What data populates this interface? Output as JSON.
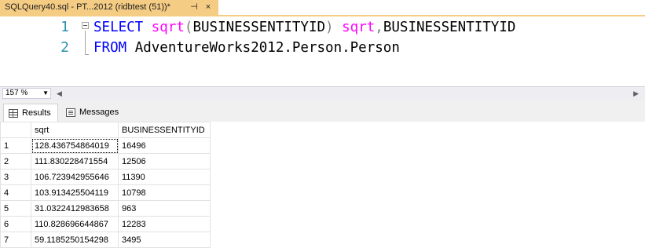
{
  "tab": {
    "title": "SQLQuery40.sql - PT...2012 (ridbtest (51))*",
    "pin_glyph": "⊣",
    "close_glyph": "×"
  },
  "editor": {
    "lines": [
      {
        "num": "1"
      },
      {
        "num": "2"
      }
    ],
    "line1": {
      "kw_select": "SELECT",
      "fn_sqrt": "sqrt",
      "paren_open": "(",
      "col": "BUSINESSENTITYID",
      "paren_close": ")",
      "alias": "sqrt",
      "comma": ",",
      "col2": "BUSINESSENTITYID"
    },
    "line2": {
      "kw_from": "FROM",
      "table": "AdventureWorks2012.Person.Person"
    }
  },
  "zoom": {
    "value": "157 %"
  },
  "results_tabs": {
    "results_label": "Results",
    "messages_label": "Messages"
  },
  "grid": {
    "columns": [
      "sqrt",
      "BUSINESSENTITYID"
    ],
    "rows": [
      {
        "n": "1",
        "sqrt": "128.436754864019",
        "id": "16496"
      },
      {
        "n": "2",
        "sqrt": "111.830228471554",
        "id": "12506"
      },
      {
        "n": "3",
        "sqrt": "106.723942955646",
        "id": "11390"
      },
      {
        "n": "4",
        "sqrt": "103.913425504119",
        "id": "10798"
      },
      {
        "n": "5",
        "sqrt": "31.0322412983658",
        "id": "963"
      },
      {
        "n": "6",
        "sqrt": "110.828696644867",
        "id": "12283"
      },
      {
        "n": "7",
        "sqrt": "59.1185250154298",
        "id": "3495"
      }
    ]
  }
}
